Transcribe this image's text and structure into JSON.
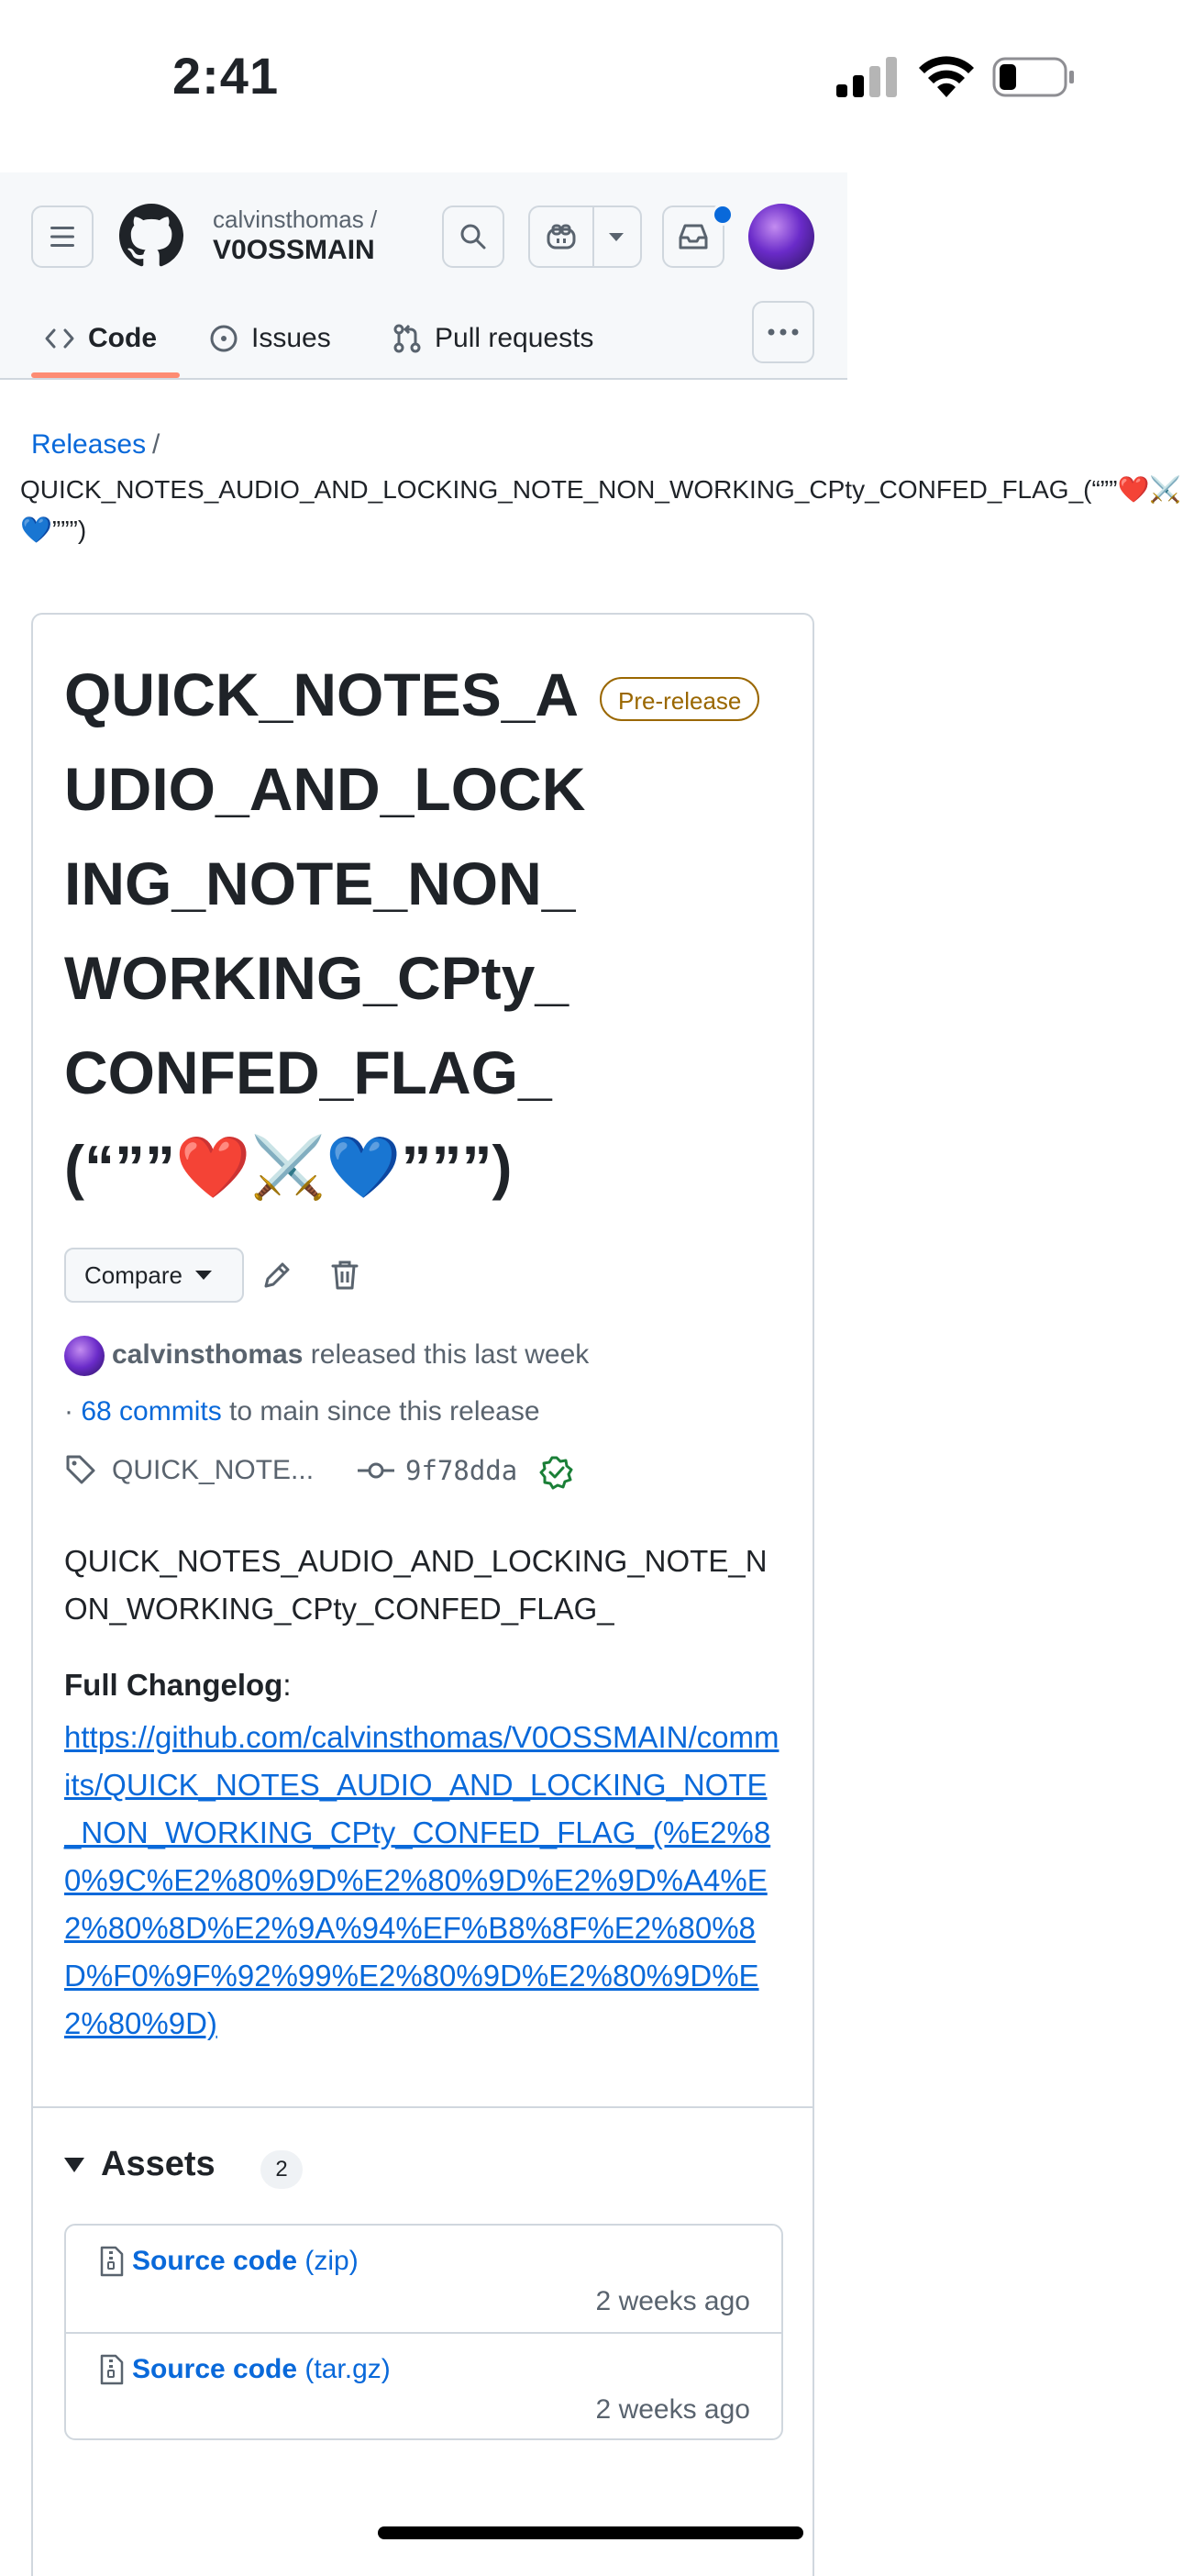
{
  "status_bar": {
    "time": "2:41"
  },
  "header": {
    "owner": "calvinsthomas /",
    "repo": "V0OSSMAIN",
    "tabs": [
      {
        "label": "Code",
        "selected": true
      },
      {
        "label": "Issues",
        "selected": false
      },
      {
        "label": "Pull requests",
        "selected": false
      }
    ]
  },
  "breadcrumb": {
    "link": "Releases",
    "separator": "/",
    "current": "QUICK_NOTES_AUDIO_AND_LOCKING_NOTE_NON_WORKING_CPty_CONFED_FLAG_(“””❤️⚔️💙”””)"
  },
  "release": {
    "title": "QUICK_NOTES_AUDIO_AND_LOCKING_NOTE_NON_WORKING_CPty_CONFED_FLAG_(“””❤️⚔️💙”””)",
    "badge": "Pre-release",
    "compare_label": "Compare",
    "author": "calvinsthomas",
    "released_text": "released this last week",
    "commits_prefix": "· ",
    "commits_link": "68 commits",
    "commits_suffix": " to main since this release",
    "tag": "QUICK_NOTE...",
    "commit_sha": "9f78dda",
    "body": "QUICK_NOTES_AUDIO_AND_LOCKING_NOTE_NON_WORKING_CPty_CONFED_FLAG_",
    "changelog_label": "Full Changelog",
    "changelog_colon": ":",
    "changelog_url": "https://github.com/calvinsthomas/V0OSSMAIN/commits/QUICK_NOTES_AUDIO_AND_LOCKING_NOTE_NON_WORKING_CPty_CONFED_FLAG_(%E2%80%9C%E2%80%9D%E2%80%9D%E2%9D%A4%E2%80%8D%E2%9A%94%EF%B8%8F%E2%80%8D%F0%9F%92%99%E2%80%9D%E2%80%9D%E2%80%9D)"
  },
  "assets": {
    "title": "Assets",
    "count": "2",
    "items": [
      {
        "name": "Source code",
        "kind": " (zip)",
        "date": "2 weeks ago"
      },
      {
        "name": "Source code",
        "kind": " (tar.gz)",
        "date": "2 weeks ago"
      }
    ]
  },
  "colors": {
    "accent": "#0969da",
    "prerelease": "#9a6700",
    "tab_underline": "#fd8c73",
    "verified": "#1a7f37"
  }
}
